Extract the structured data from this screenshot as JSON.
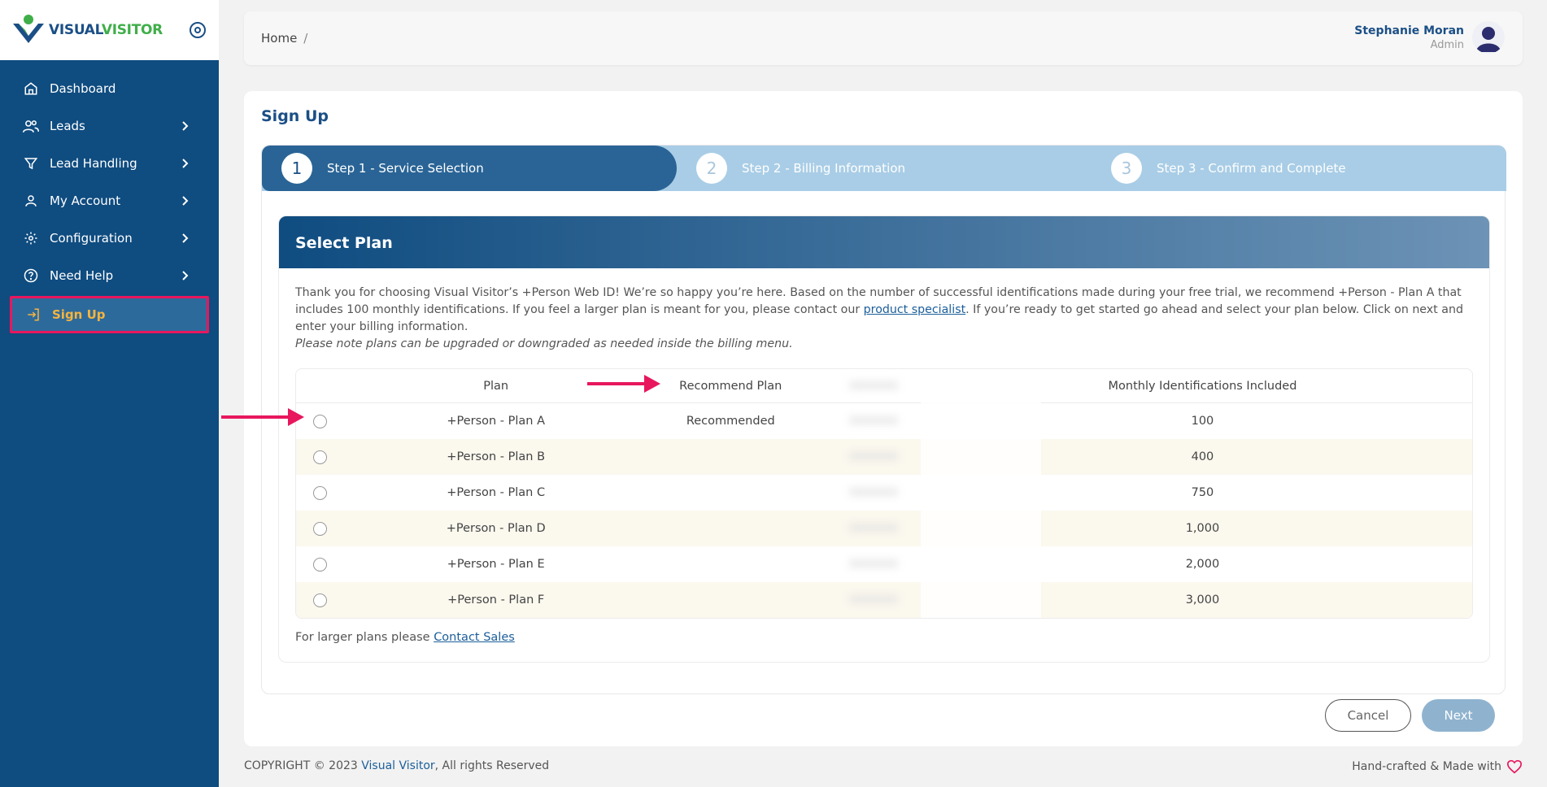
{
  "brand": {
    "name_part1": "VISUAL",
    "name_part2": "VISITOR",
    "colors": {
      "sidebar": "#0f4c80",
      "accent_orange": "#f5b43e",
      "highlight": "#e8175d",
      "green": "#3fae49"
    }
  },
  "sidebar": {
    "items": [
      {
        "label": "Dashboard",
        "icon": "home-icon",
        "has_children": false
      },
      {
        "label": "Leads",
        "icon": "users-icon",
        "has_children": true
      },
      {
        "label": "Lead Handling",
        "icon": "filter-icon",
        "has_children": true
      },
      {
        "label": "My Account",
        "icon": "user-icon",
        "has_children": true
      },
      {
        "label": "Configuration",
        "icon": "gear-icon",
        "has_children": true
      },
      {
        "label": "Need Help",
        "icon": "help-icon",
        "has_children": true
      },
      {
        "label": "Sign Up",
        "icon": "sign-in-icon",
        "has_children": false,
        "active": true
      }
    ]
  },
  "header": {
    "breadcrumb": {
      "home": "Home",
      "separator": "/"
    },
    "user": {
      "name": "Stephanie Moran",
      "role": "Admin"
    }
  },
  "page": {
    "title": "Sign Up",
    "steps": [
      {
        "number": "1",
        "label": "Step 1 - Service Selection",
        "current": true
      },
      {
        "number": "2",
        "label": "Step 2 - Billing Information",
        "current": false
      },
      {
        "number": "3",
        "label": "Step 3 - Confirm and Complete",
        "current": false
      }
    ],
    "plan_card": {
      "title": "Select Plan",
      "intro_part1": "Thank you for choosing Visual Visitor’s +Person Web ID! We’re so happy you’re here. Based on the number of successful identifications made during your free trial, we recommend +Person - Plan A that includes 100 monthly identifications. If you feel a larger plan is meant for you, please contact our ",
      "intro_link": "product specialist",
      "intro_part2": ". If you’re ready to get started go ahead and select your plan below. Click on next and enter your billing information.",
      "note": "Please note plans can be upgraded or downgraded as needed inside the billing menu.",
      "table": {
        "headers": {
          "plan": "Plan",
          "recommend": "Recommend Plan",
          "monthly": "Monthly Identifications Included"
        },
        "rows": [
          {
            "plan": "+Person - Plan A",
            "recommend": "Recommended",
            "monthly": "100"
          },
          {
            "plan": "+Person - Plan B",
            "recommend": "",
            "monthly": "400"
          },
          {
            "plan": "+Person - Plan C",
            "recommend": "",
            "monthly": "750"
          },
          {
            "plan": "+Person - Plan D",
            "recommend": "",
            "monthly": "1,000"
          },
          {
            "plan": "+Person - Plan E",
            "recommend": "",
            "monthly": "2,000"
          },
          {
            "plan": "+Person - Plan F",
            "recommend": "",
            "monthly": "3,000"
          }
        ]
      },
      "larger_text": "For larger plans please ",
      "larger_link": "Contact Sales"
    },
    "buttons": {
      "cancel": "Cancel",
      "next": "Next"
    }
  },
  "footer": {
    "copyright_prefix": "COPYRIGHT © 2023 ",
    "copyright_brand": "Visual Visitor",
    "copyright_suffix": ", All rights Reserved",
    "made_with": "Hand-crafted & Made with"
  }
}
